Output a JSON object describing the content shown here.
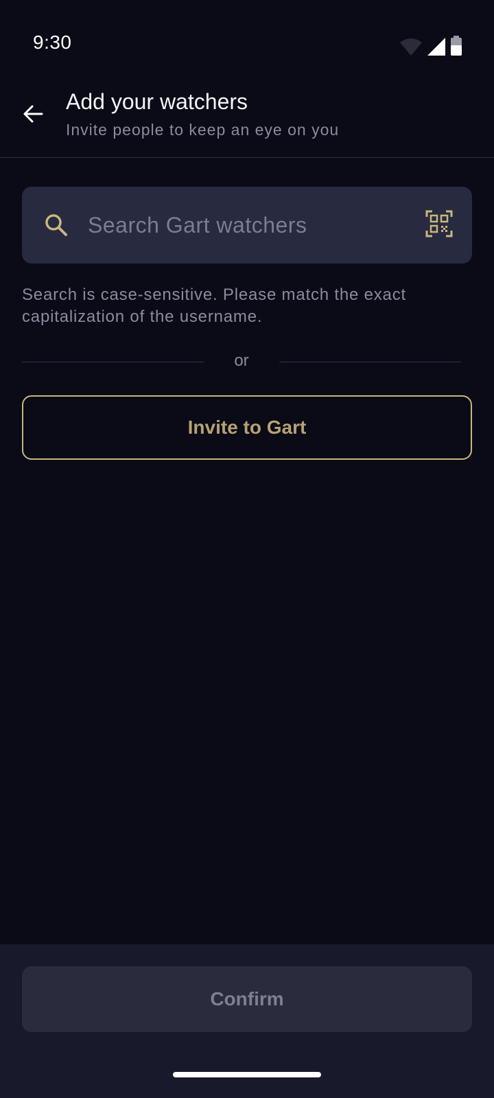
{
  "status_bar": {
    "time": "9:30",
    "icons": [
      "wifi-icon",
      "cellular-signal-icon",
      "battery-icon"
    ]
  },
  "header": {
    "title": "Add your watchers",
    "subtitle": "Invite people to keep an eye on you",
    "back_icon": "arrow-left-icon"
  },
  "search": {
    "placeholder": "Search Gart watchers",
    "value": "",
    "icon": "search-icon",
    "qr_icon": "qr-code-icon",
    "hint": "Search is case-sensitive. Please match the exact capitalization of the username."
  },
  "divider": {
    "label": "or"
  },
  "invite_button": {
    "label": "Invite to Gart"
  },
  "confirm_button": {
    "label": "Confirm"
  },
  "colors": {
    "background": "#0a0b16",
    "panel": "#181a2b",
    "input": "#282a40",
    "accent_gold": "#c9b77e",
    "muted_text": "#8a8c9e"
  }
}
